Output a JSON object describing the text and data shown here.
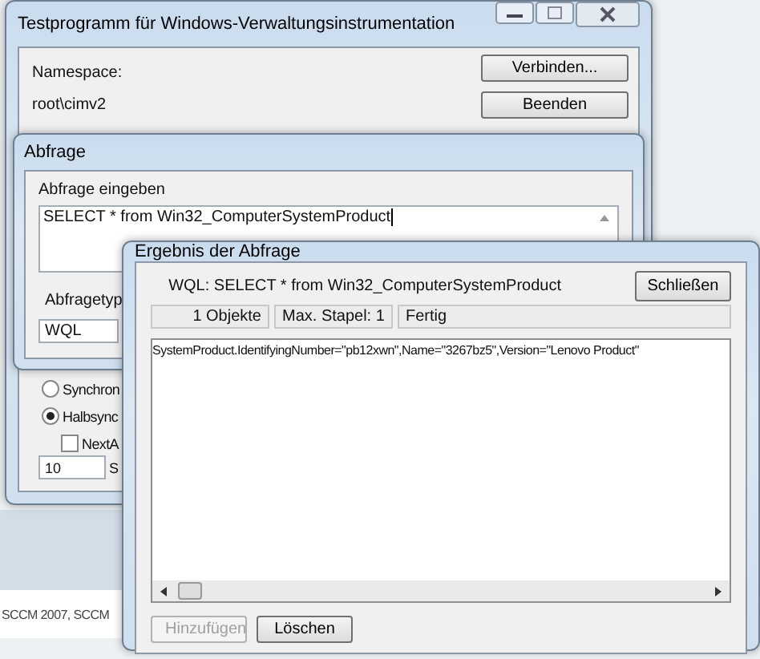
{
  "main_window": {
    "title": "Testprogramm für Windows-Verwaltungsinstrumentation",
    "namespace_label": "Namespace:",
    "namespace": "root\\cimv2",
    "buttons": [
      {
        "label": "Verbinden...",
        "disabled": false
      },
      {
        "label": "Beenden",
        "disabled": false
      }
    ],
    "options": [
      {
        "kind": "radio",
        "label": "Synchron",
        "checked": false
      },
      {
        "kind": "radio",
        "label": "Halbsync",
        "checked": true
      },
      {
        "kind": "checkbox",
        "label": "NextA",
        "checked": false
      }
    ],
    "batch_field": {
      "value": "10"
    },
    "batch_label": "S"
  },
  "query_window": {
    "title": "Abfrage",
    "query_label": "Abfrage eingeben",
    "query": "SELECT * from Win32_ComputerSystemProduct",
    "type_label": "Abfragetyp",
    "type": "WQL"
  },
  "result_window": {
    "title": "Ergebnis der Abfrage",
    "query": "WQL: SELECT * from Win32_ComputerSystemProduct",
    "close_button": "Schließen",
    "status": [
      "1 Objekte",
      "Max. Stapel: 1",
      "Fertig"
    ],
    "results": [
      "SystemProduct.IdentifyingNumber=\"pb12xwn\",Name=\"3267bz5\",Version=\"Lenovo Product\""
    ],
    "buttons": [
      {
        "label": "Hinzufügen",
        "disabled": true
      },
      {
        "label": "Löschen",
        "disabled": false
      }
    ]
  },
  "background_text": "SCCM 2007, SCCM"
}
